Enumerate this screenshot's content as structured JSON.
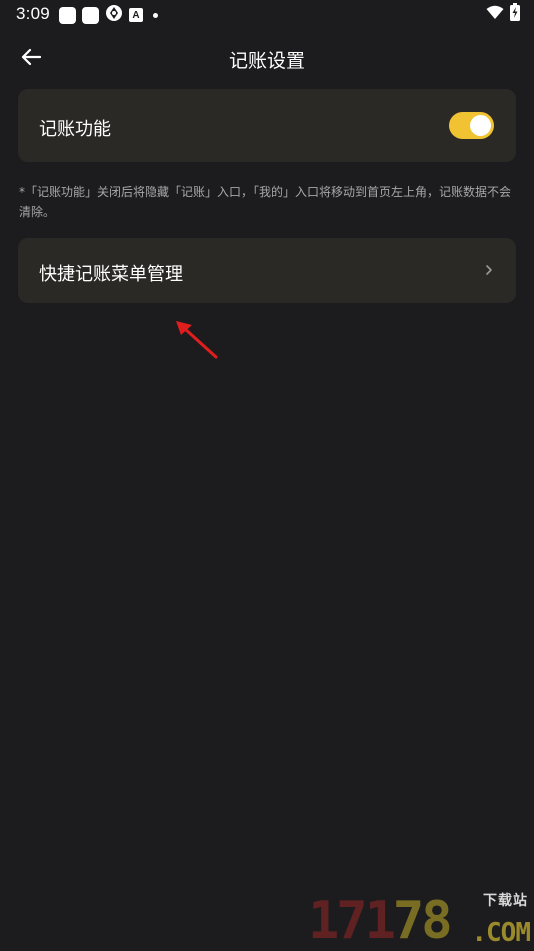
{
  "status_bar": {
    "time": "3:09",
    "icons_left": [
      "app-square-icon",
      "app-square-icon",
      "network-icon",
      "a-app-icon",
      "dot-icon"
    ],
    "icons_right": [
      "wifi-icon",
      "battery-charging-icon"
    ],
    "a_icon_letter": "A"
  },
  "app_bar": {
    "title": "记账设置",
    "back_icon": "back-arrow-icon"
  },
  "settings": {
    "toggle_item": {
      "label": "记账功能",
      "enabled": true
    },
    "note": "*「记账功能」关闭后将隐藏「记账」入口，「我的」入口将移动到首页左上角，记账数据不会清除。",
    "menu_item": {
      "label": "快捷记账菜单管理",
      "icon": "chevron-right-icon"
    }
  },
  "watermark": {
    "number_red": "171",
    "number_gold": "78",
    "sub": "下载站",
    "domain": ".COM"
  },
  "colors": {
    "background": "#1c1c1e",
    "card": "#2b2926",
    "accent_toggle": "#f1c232",
    "note_text": "#a7a7a7",
    "arrow_annotation": "#e01e1e"
  }
}
